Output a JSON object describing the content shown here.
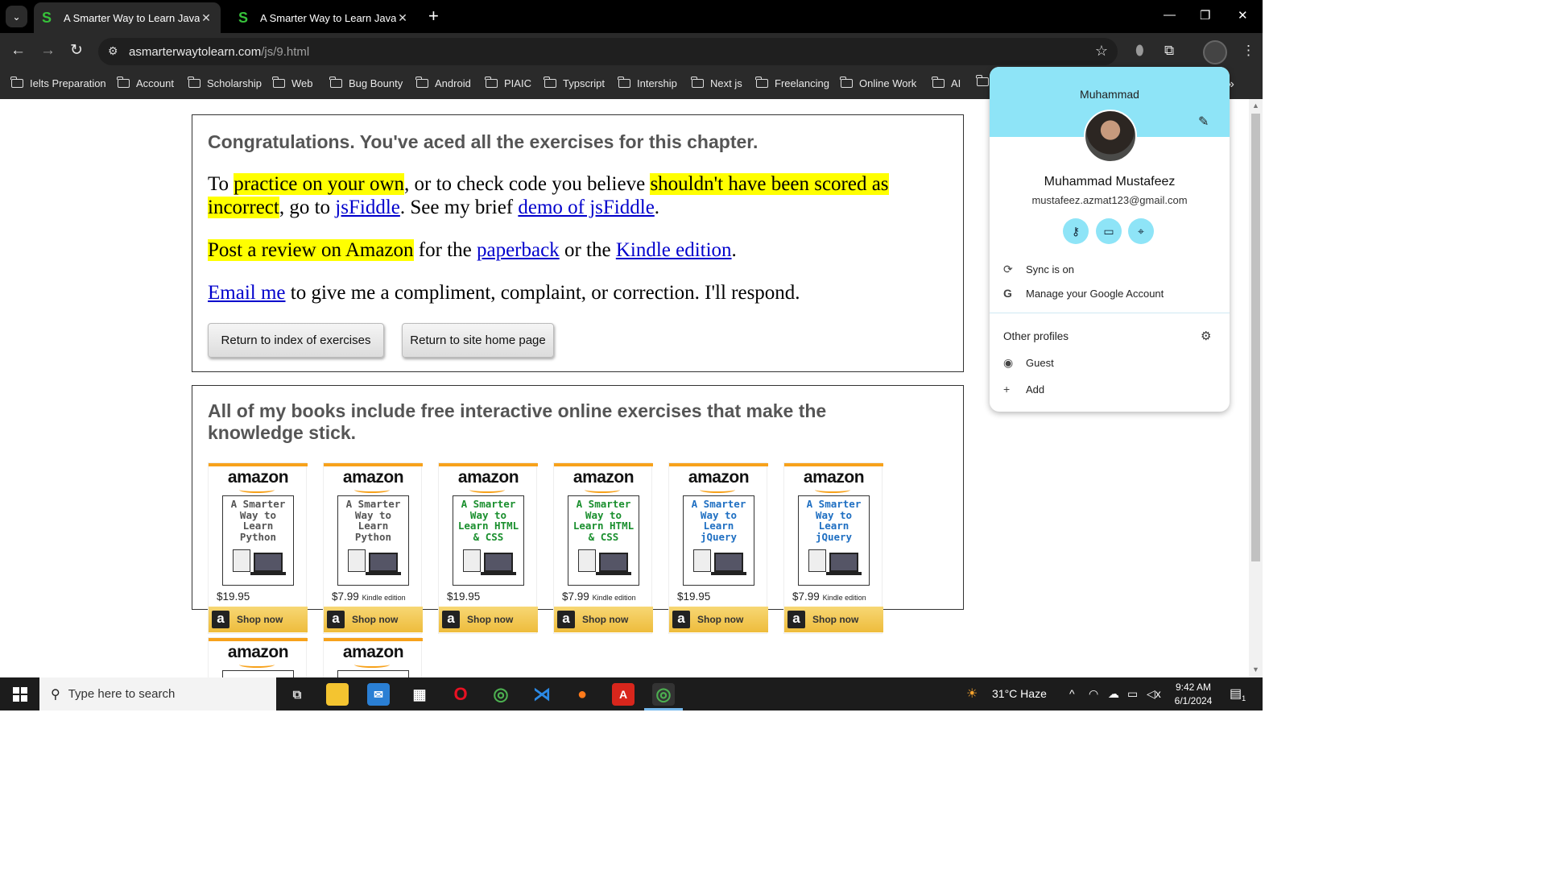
{
  "browser": {
    "tabs": [
      {
        "title": "A Smarter Way to Learn JavaScr",
        "favicon": "S",
        "active": true
      },
      {
        "title": "A Smarter Way to Learn JavaScr",
        "favicon": "S",
        "active": false
      }
    ],
    "url_host": "asmarterwaytolearn.com",
    "url_path": "/js/9.html",
    "bookmarks": [
      "Ielts Preparation",
      "Account",
      "Scholarship",
      "Web",
      "Bug Bounty",
      "Android",
      "PIAIC",
      "Typscript",
      "Intership",
      "Next js",
      "Freelancing",
      "Online Work",
      "AI"
    ]
  },
  "page": {
    "congrats": "Congratulations. You've aced all the exercises for this chapter.",
    "p1": {
      "a": "To ",
      "hl1": "practice on your own",
      "b": ", or to check code you believe ",
      "hl2": "shouldn't have been scored as incorrect",
      "c": ", go to ",
      "link1": "jsFiddle",
      "d": ". See my brief ",
      "link2": "demo of jsFiddle",
      "e": "."
    },
    "p2": {
      "hl": "Post a review on Amazon",
      "a": " for the ",
      "link1": "paperback",
      "b": " or the ",
      "link2": "Kindle edition",
      "c": "."
    },
    "p3": {
      "link": "Email me",
      "a": " to give me a compliment, complaint, or correction. I'll respond."
    },
    "buttons": {
      "index": "Return to index of exercises",
      "home": "Return to site home page"
    },
    "books_heading": "All of my books include free interactive online exercises that make the knowledge stick.",
    "books": [
      {
        "title": "A Smarter Way to Learn Python",
        "price": "$19.95",
        "edition": "",
        "title_color": "#555555"
      },
      {
        "title": "A Smarter Way to Learn Python",
        "price": "$7.99",
        "edition": "Kindle edition",
        "title_color": "#555555"
      },
      {
        "title": "A Smarter Way to Learn HTML & CSS",
        "price": "$19.95",
        "edition": "",
        "title_color": "#1a8f2e"
      },
      {
        "title": "A Smarter Way to Learn HTML & CSS",
        "price": "$7.99",
        "edition": "Kindle edition",
        "title_color": "#1a8f2e"
      },
      {
        "title": "A Smarter Way to Learn jQuery",
        "price": "$19.95",
        "edition": "",
        "title_color": "#1f6fc2"
      },
      {
        "title": "A Smarter Way to Learn jQuery",
        "price": "$7.99",
        "edition": "Kindle edition",
        "title_color": "#1f6fc2"
      }
    ],
    "amazon_logo": "amazon",
    "shop_label": "Shop now"
  },
  "profile": {
    "first_name": "Muhammad",
    "full_name": "Muhammad Mustafeez",
    "email": "mustafeez.azmat123@gmail.com",
    "sync": "Sync is on",
    "manage": "Manage your Google Account",
    "other_profiles": "Other profiles",
    "guest": "Guest",
    "add": "Add"
  },
  "taskbar": {
    "search_placeholder": "Type here to search",
    "weather": "31°C  Haze",
    "time": "9:42 AM",
    "date": "6/1/2024",
    "notifications": "1"
  },
  "colors": {
    "highlight": "#ffff00",
    "link": "#0000cc",
    "profile_banner": "#8ee4f7",
    "amazon_orange": "#f7a21b"
  }
}
